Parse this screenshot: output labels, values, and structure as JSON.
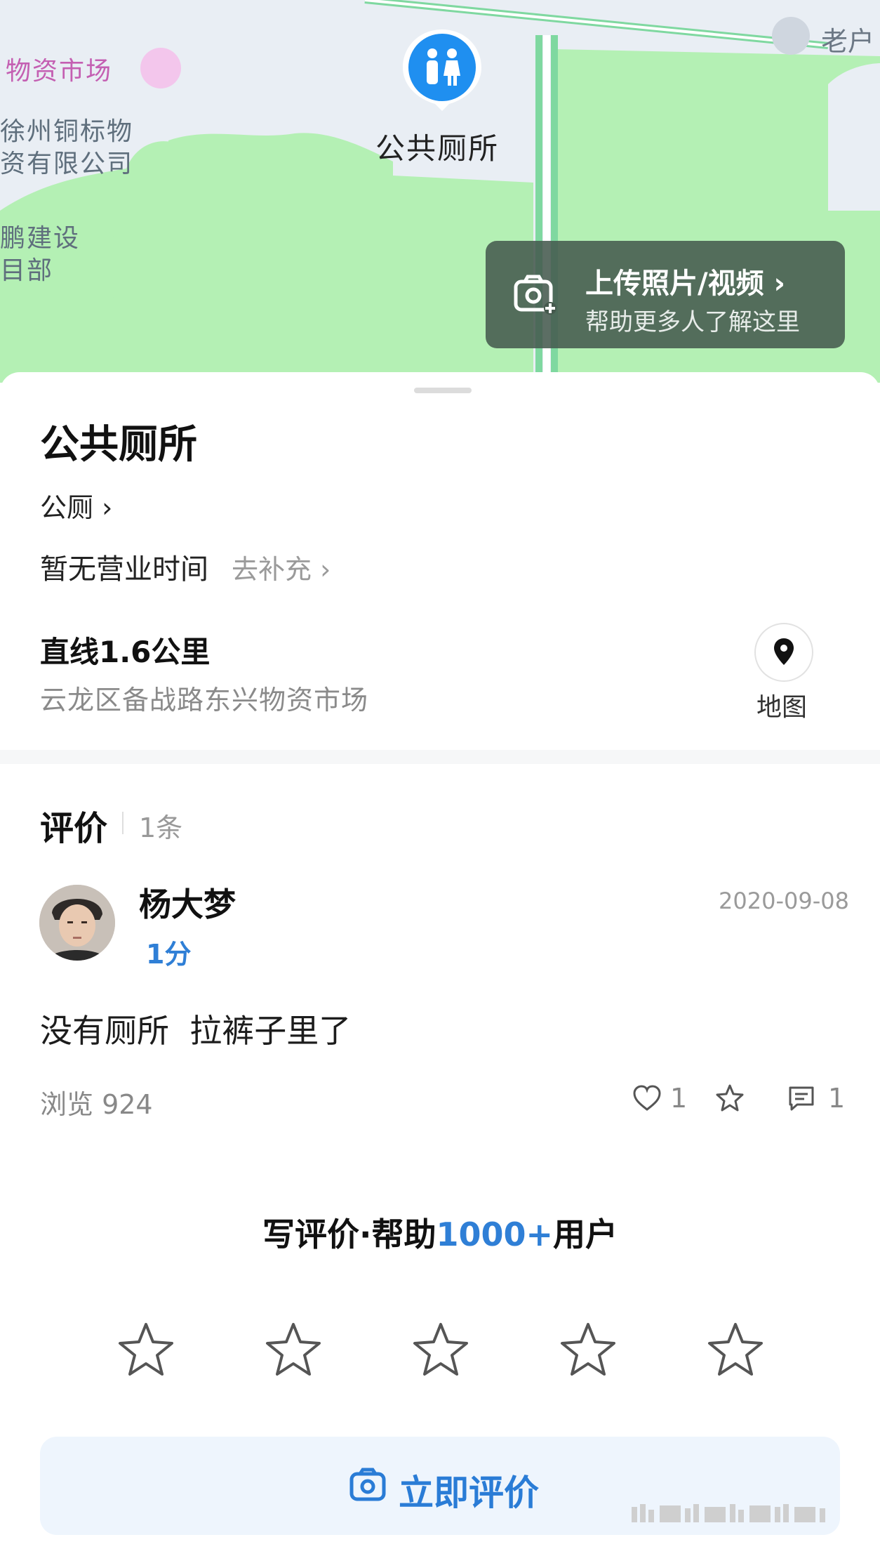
{
  "map": {
    "poi_label": "公共厕所",
    "places": [
      "物资市场",
      "徐州铜标物",
      "资有限公司",
      "鹏建设",
      "目部"
    ],
    "corner_label": "老户",
    "upload": {
      "title": "上传照片/视频 ›",
      "subtitle": "帮助更多人了解这里"
    }
  },
  "place": {
    "title": "公共厕所",
    "category": "公厕 ›",
    "hours": "暂无营业时间",
    "hours_action": "去补充 ›",
    "distance": "直线1.6公里",
    "address": "云龙区备战路东兴物资市场",
    "map_button": "地图"
  },
  "reviews": {
    "title": "评价",
    "count": "1条",
    "items": [
      {
        "user": "杨大梦",
        "date": "2020-09-08",
        "score": "1分",
        "content": "没有厕所  拉裤子里了",
        "views": "浏览 924",
        "likes": "1",
        "comments": "1"
      }
    ]
  },
  "write": {
    "prefix": "写评价·帮助",
    "highlight": "1000+",
    "suffix": "用户",
    "cta": "立即评价",
    "rating_max": 5
  },
  "colors": {
    "accent": "#2f7fd6",
    "map_green": "#b4f0b4",
    "pin_blue": "#1f8ff0"
  }
}
